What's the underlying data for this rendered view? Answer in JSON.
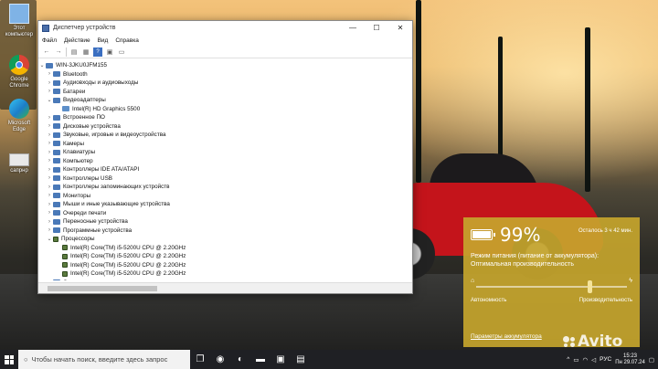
{
  "desktop": {
    "icons": [
      {
        "label": "Этот компьютер",
        "icon": "computer-icon"
      },
      {
        "label": "Google Chrome",
        "icon": "chrome-icon"
      },
      {
        "label": "Microsoft Edge",
        "icon": "edge-icon"
      },
      {
        "label": "сапрнр",
        "icon": "shortcut-icon"
      }
    ]
  },
  "window": {
    "title": "Диспетчер устройств",
    "minimize": "—",
    "maximize": "☐",
    "close": "✕",
    "menu": [
      "Файл",
      "Действие",
      "Вид",
      "Справка"
    ],
    "tree": {
      "root": "WIN-3JKU0JFM155",
      "items": [
        {
          "label": "Bluetooth",
          "expander": "›"
        },
        {
          "label": "Аудиовходы и аудиовыходы",
          "expander": "›"
        },
        {
          "label": "Батареи",
          "expander": "›"
        },
        {
          "label": "Видеоадаптеры",
          "expander": "⌄"
        },
        {
          "label": "Intel(R) HD Graphics 5500",
          "child": true,
          "kind": "gpu"
        },
        {
          "label": "Встроенное ПО",
          "expander": "›"
        },
        {
          "label": "Дисковые устройства",
          "expander": "›"
        },
        {
          "label": "Звуковые, игровые и видеоустройства",
          "expander": "›"
        },
        {
          "label": "Камеры",
          "expander": "›"
        },
        {
          "label": "Клавиатуры",
          "expander": "›"
        },
        {
          "label": "Компьютер",
          "expander": "›"
        },
        {
          "label": "Контроллеры IDE ATA/ATAPI",
          "expander": "›"
        },
        {
          "label": "Контроллеры USB",
          "expander": "›"
        },
        {
          "label": "Контроллеры запоминающих устройств",
          "expander": "›"
        },
        {
          "label": "Мониторы",
          "expander": "›"
        },
        {
          "label": "Мыши и иные указывающие устройства",
          "expander": "›"
        },
        {
          "label": "Очереди печати",
          "expander": "›"
        },
        {
          "label": "Переносные устройства",
          "expander": "›"
        },
        {
          "label": "Программные устройства",
          "expander": "›"
        },
        {
          "label": "Процессоры",
          "expander": "⌄",
          "kind": "cpu"
        },
        {
          "label": "Intel(R) Core(TM) i5-5200U CPU @ 2.20GHz",
          "child": true,
          "kind": "cpu"
        },
        {
          "label": "Intel(R) Core(TM) i5-5200U CPU @ 2.20GHz",
          "child": true,
          "kind": "cpu"
        },
        {
          "label": "Intel(R) Core(TM) i5-5200U CPU @ 2.20GHz",
          "child": true,
          "kind": "cpu"
        },
        {
          "label": "Intel(R) Core(TM) i5-5200U CPU @ 2.20GHz",
          "child": true,
          "kind": "cpu"
        },
        {
          "label": "Сетевые адаптеры",
          "expander": "›"
        }
      ]
    }
  },
  "battery": {
    "percent_text": "99%",
    "percent": 99,
    "remaining": "Осталось 3 ч 42 мин.",
    "mode_label": "Режим питания (питание от аккумулятора):",
    "mode_value": "Оптимальная производительность",
    "slider_left": "Автономность",
    "slider_right": "Производительность",
    "slider_position": 0.75,
    "settings_link": "Параметры аккумулятора",
    "accent": "#c5a52d"
  },
  "taskbar": {
    "search_placeholder": "Чтобы начать поиск, введите здесь запрос",
    "lang": "РУС",
    "time": "15:23",
    "date": "Пн 29.07.24"
  },
  "watermark": "Avito"
}
